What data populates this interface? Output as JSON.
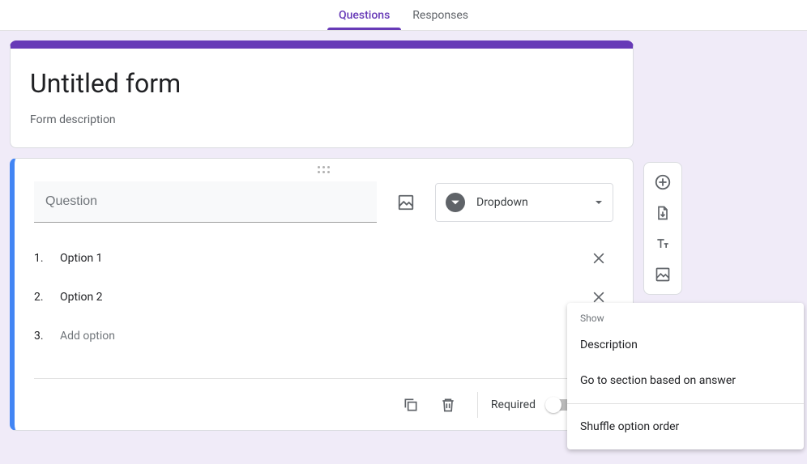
{
  "tabs": {
    "questions": "Questions",
    "responses": "Responses"
  },
  "form": {
    "title": "Untitled form",
    "description": "Form description"
  },
  "question": {
    "placeholder": "Question",
    "type_label": "Dropdown",
    "options": [
      {
        "num": "1.",
        "label": "Option 1"
      },
      {
        "num": "2.",
        "label": "Option 2"
      }
    ],
    "add_option_num": "3.",
    "add_option_label": "Add option",
    "required_label": "Required"
  },
  "popup": {
    "header": "Show",
    "item_description": "Description",
    "item_goto": "Go to section based on answer",
    "item_shuffle": "Shuffle option order"
  }
}
